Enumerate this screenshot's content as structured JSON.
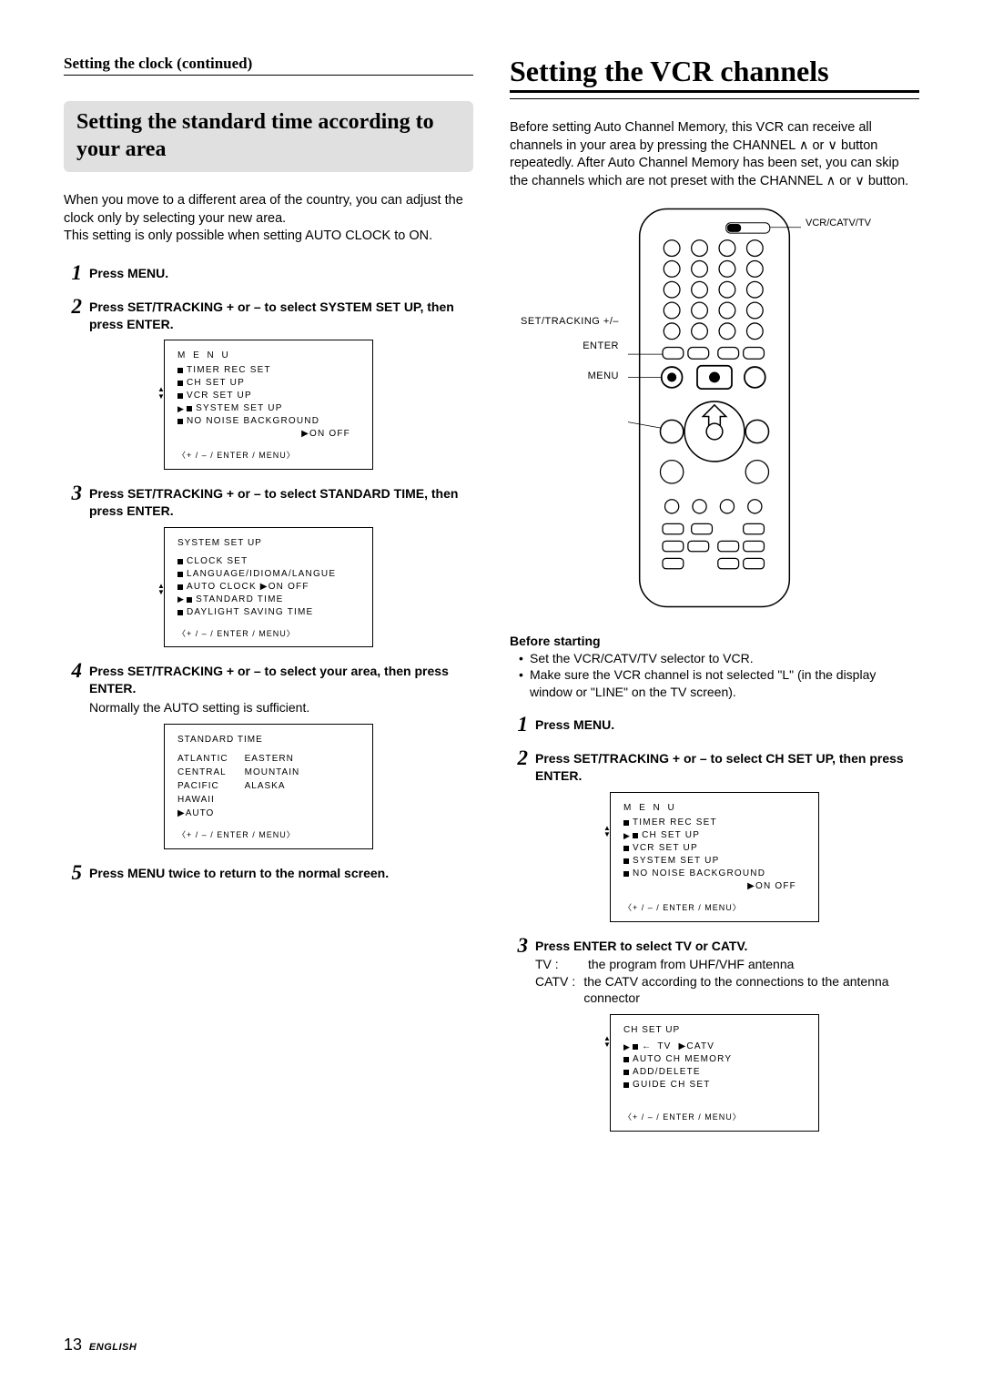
{
  "left": {
    "continued": "Setting the clock (continued)",
    "banner": "Setting the standard time according to your area",
    "intro1": "When you move to a different area of the country, you can adjust the clock only by selecting your new area.",
    "intro2": "This setting is only possible when setting AUTO CLOCK to ON.",
    "steps": {
      "s1": "Press MENU.",
      "s2": "Press SET/TRACKING + or – to select SYSTEM SET UP, then press ENTER.",
      "s3": "Press SET/TRACKING + or – to select STANDARD TIME, then press ENTER.",
      "s4": "Press SET/TRACKING + or – to select your area, then press ENTER.",
      "s4note": "Normally the AUTO setting is sufficient.",
      "s5": "Press MENU twice to return to the normal screen."
    },
    "osd1": {
      "title": "M E N U",
      "items": [
        "TIMER REC SET",
        "CH SET UP",
        "VCR SET UP",
        "SYSTEM SET UP",
        "NO NOISE BACKGROUND"
      ],
      "opt": "▶ON   OFF",
      "hint": "〈+ / – / ENTER / MENU〉"
    },
    "osd2": {
      "title": "SYSTEM SET UP",
      "items": [
        "CLOCK SET",
        "LANGUAGE/IDIOMA/LANGUE",
        "AUTO CLOCK ▶ON   OFF",
        "STANDARD TIME",
        "DAYLIGHT SAVING TIME"
      ],
      "hint": "〈+ / – / ENTER / MENU〉"
    },
    "osd3": {
      "title": "STANDARD TIME",
      "colA": [
        "ATLANTIC",
        "CENTRAL",
        "PACIFIC",
        "HAWAII",
        "▶AUTO"
      ],
      "colB": [
        "EASTERN",
        "MOUNTAIN",
        "ALASKA"
      ],
      "hint": "〈+ / – / ENTER / MENU〉"
    }
  },
  "right": {
    "title": "Setting the VCR channels",
    "intro": "Before setting Auto Channel Memory, this VCR can receive all channels in your area by pressing the CHANNEL ∧ or ∨ button repeatedly.  After Auto Channel Memory has been set, you can skip the channels which are not preset with the CHANNEL ∧ or ∨ button.",
    "labels": {
      "settracking": "SET/TRACKING +/–",
      "enter": "ENTER",
      "menu": "MENU",
      "vcrcatv": "VCR/CATV/TV"
    },
    "before_head": "Before starting",
    "before1": "Set the VCR/CATV/TV selector to VCR.",
    "before2": "Make sure the VCR channel is not selected \"L\" (in the display window or \"LINE\" on the TV screen).",
    "steps": {
      "s1": "Press MENU.",
      "s2": "Press SET/TRACKING + or – to select CH SET UP, then press ENTER.",
      "s3": "Press ENTER to select TV or CATV."
    },
    "s3rows": {
      "tv_lbl": "TV :",
      "tv_txt": "the program from UHF/VHF antenna",
      "catv_lbl": "CATV :",
      "catv_txt": "the CATV according to the connections to the antenna connector"
    },
    "osd1": {
      "title": "M E N U",
      "items": [
        "TIMER REC SET",
        "CH SET UP",
        "VCR SET UP",
        "SYSTEM SET UP",
        "NO NOISE BACKGROUND"
      ],
      "opt": "▶ON   OFF",
      "hint": "〈+ / – / ENTER / MENU〉"
    },
    "osd2": {
      "title": "CH SET UP",
      "line1_left": "TV",
      "line1_right": "▶CATV",
      "items": [
        "AUTO CH MEMORY",
        "ADD/DELETE",
        "GUIDE CH SET"
      ],
      "hint": "〈+ / – / ENTER / MENU〉"
    }
  },
  "footer": {
    "page": "13",
    "lang": "ENGLISH"
  }
}
